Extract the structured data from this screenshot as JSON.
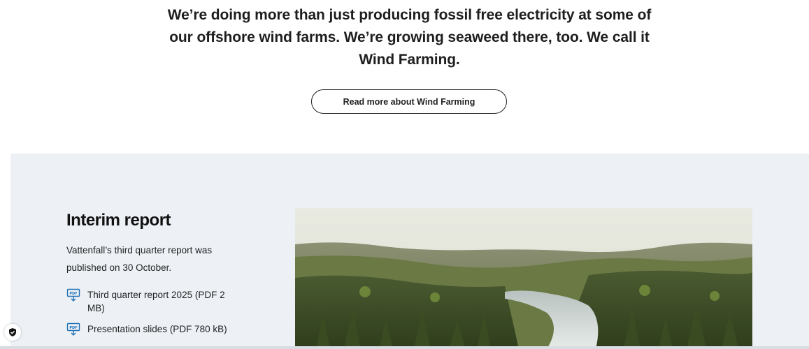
{
  "hero": {
    "text": "We’re doing more than just producing fossil free electricity at some of our offshore wind farms. We’re growing seaweed there, too. We call it Wind Farming.",
    "cta_label": "Read more about Wind Farming"
  },
  "report": {
    "title": "Interim report",
    "description": "Vattenfall’s third quarter report was published on 30 October.",
    "links": [
      {
        "label": "Third quarter report 2025 (PDF 2 MB)",
        "icon": "pdf-download-icon"
      },
      {
        "label": "Presentation slides (PDF 780 kB)",
        "icon": "pdf-download-icon"
      }
    ],
    "image": {
      "alt": "Forest river landscape"
    }
  },
  "privacy": {
    "icon": "shield-check-icon"
  },
  "colors": {
    "section_bg": "#edf1f6",
    "icon_blue": "#2071b5",
    "text": "#1e1e1e"
  }
}
